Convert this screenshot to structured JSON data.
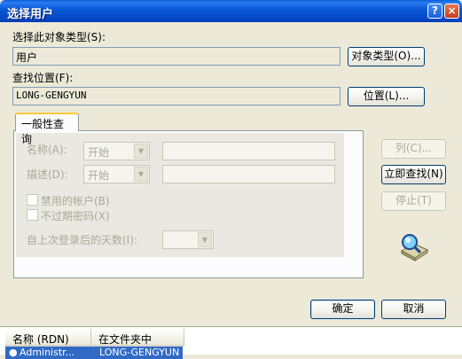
{
  "window": {
    "title": "选择用户",
    "help_glyph": "?",
    "close_glyph": "×"
  },
  "object_type": {
    "label": "选择此对象类型(S):",
    "value": "用户",
    "button": "对象类型(O)..."
  },
  "location": {
    "label": "查找位置(F):",
    "value": "LONG-GENGYUN",
    "button": "位置(L)..."
  },
  "tab": {
    "label": "一般性查询"
  },
  "query": {
    "name_label": "名称(A):",
    "name_mode": "开始",
    "desc_label": "描述(D):",
    "desc_mode": "开始",
    "disabled_accounts": "禁用的帐户(B)",
    "non_expiring_pwd": "不过期密码(X)",
    "days_since_login": "自上次登录后的天数(I):"
  },
  "side_buttons": {
    "columns": "列(C)...",
    "find_now": "立即查找(N)",
    "stop": "停止(T)"
  },
  "footer": {
    "ok": "确定",
    "cancel": "取消"
  },
  "results": {
    "columns": [
      "名称 (RDN)",
      "在文件夹中"
    ],
    "rows": [
      {
        "name": "Administr...",
        "folder": "LONG-GENGYUN"
      }
    ]
  },
  "colors": {
    "title_bar": "#0a5ad8",
    "selection": "#316ac5",
    "tab_accent": "#ffc83c"
  }
}
